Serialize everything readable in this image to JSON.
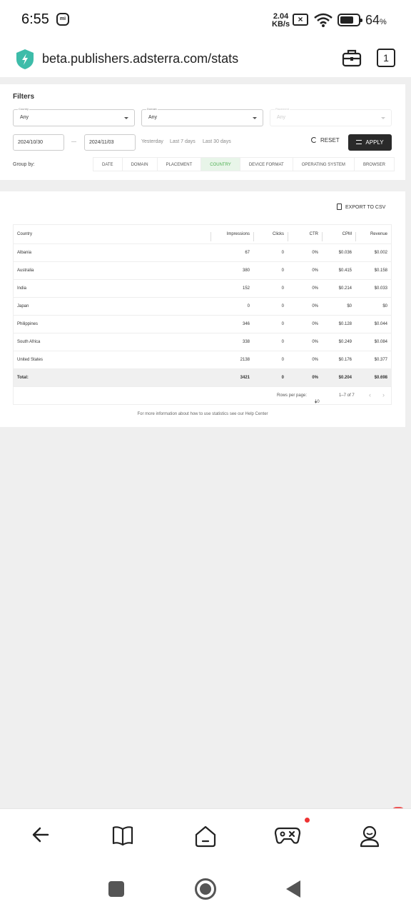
{
  "status_bar": {
    "time": "6:55",
    "mi_badge": "mi",
    "speed_value": "2.04",
    "speed_unit": "KB/s",
    "battery_percent": "64",
    "battery_symbol": "%"
  },
  "browser": {
    "url": "beta.publishers.adsterra.com/stats",
    "tab_count": "1",
    "shield_color": "#3dbca9"
  },
  "filters": {
    "title": "Filters",
    "country_label": "Country",
    "country_value": "Any",
    "domain_label": "Domain",
    "domain_value": "Any",
    "placement_label": "Placement",
    "placement_value": "Any",
    "date_from": "2024/10/30",
    "date_sep": "—",
    "date_to": "2024/11/03",
    "quick": [
      "Yesterday",
      "Last 7 days",
      "Last 30 days"
    ],
    "reset_label": "RESET",
    "apply_label": "APPLY",
    "group_by_label": "Group by:",
    "group_tabs": [
      "DATE",
      "DOMAIN",
      "PLACEMENT",
      "COUNTRY",
      "DEVICE FORMAT",
      "OPERATING SYSTEM",
      "BROWSER"
    ],
    "active_tab": "COUNTRY",
    "active_color": "#4caf50"
  },
  "stats": {
    "export_label": "EXPORT TO CSV",
    "columns": [
      "Country",
      "Impressions",
      "Clicks",
      "CTR",
      "CPM",
      "Revenue"
    ],
    "rows": [
      [
        "Albania",
        "67",
        "0",
        "0%",
        "$0.036",
        "$0.002"
      ],
      [
        "Australia",
        "380",
        "0",
        "0%",
        "$0.415",
        "$0.158"
      ],
      [
        "India",
        "152",
        "0",
        "0%",
        "$0.214",
        "$0.033"
      ],
      [
        "Japan",
        "0",
        "0",
        "0%",
        "$0",
        "$0"
      ],
      [
        "Philippines",
        "346",
        "0",
        "0%",
        "$0.128",
        "$0.044"
      ],
      [
        "South Africa",
        "338",
        "0",
        "0%",
        "$0.249",
        "$0.084"
      ],
      [
        "United States",
        "2138",
        "0",
        "0%",
        "$0.176",
        "$0.377"
      ]
    ],
    "total": [
      "Total:",
      "3421",
      "0",
      "0%",
      "$0.204",
      "$0.698"
    ],
    "rows_per_page_label": "Rows per page:",
    "rows_per_page_value": "10",
    "range_text": "1–7 of 7",
    "help_text": "For more information about how to use statistics see our Help Center"
  },
  "bottom_nav": {
    "icons": [
      "back-arrow-icon",
      "book-icon",
      "home-icon",
      "gamepad-icon",
      "profile-icon"
    ],
    "notification_color": "#e33333"
  }
}
